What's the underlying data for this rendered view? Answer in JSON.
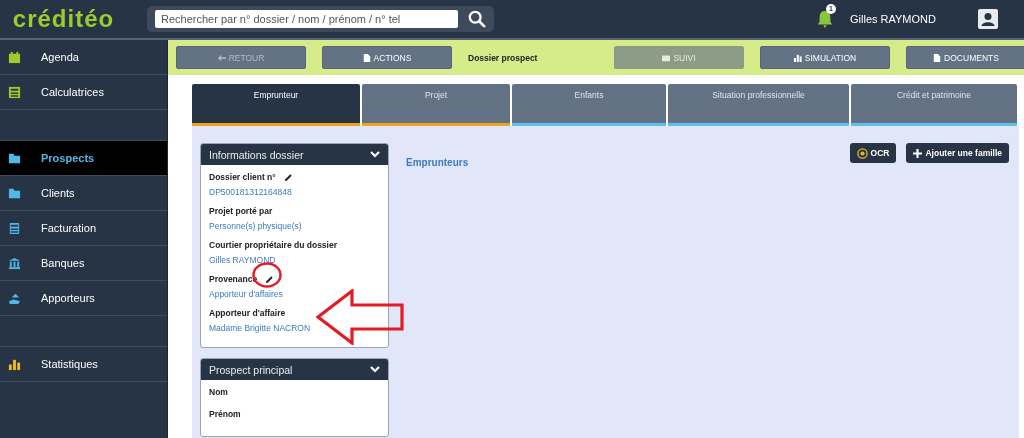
{
  "header": {
    "logo": "créditéo",
    "search": {
      "placeholder": "Rechercher par n° dossier / nom / prénom / n° tel"
    },
    "notifications": "1",
    "user": "Gilles RAYMOND"
  },
  "sidebar": {
    "items": [
      {
        "kind": "link",
        "label": "Agenda",
        "selected": false
      },
      {
        "kind": "link",
        "label": "Calculatrices",
        "selected": false
      },
      {
        "kind": "spacer"
      },
      {
        "kind": "link",
        "label": "Prospects",
        "selected": true
      },
      {
        "kind": "link",
        "label": "Clients",
        "selected": false
      },
      {
        "kind": "link",
        "label": "Facturation",
        "selected": false
      },
      {
        "kind": "link",
        "label": "Banques",
        "selected": false
      },
      {
        "kind": "link",
        "label": "Apporteurs",
        "selected": false
      },
      {
        "kind": "spacer"
      },
      {
        "kind": "link",
        "label": "Statistiques",
        "selected": false
      }
    ]
  },
  "toolbar": {
    "items": [
      {
        "kind": "button",
        "label": "RETOUR",
        "disabled": true
      },
      {
        "kind": "button",
        "label": "ACTIONS",
        "disabled": false
      },
      {
        "kind": "title",
        "label": "Dossier prospect"
      },
      {
        "kind": "button",
        "label": "SUIVI",
        "disabled": true
      },
      {
        "kind": "button",
        "label": "SIMULATION",
        "disabled": false
      },
      {
        "kind": "button",
        "label": "DOCUMENTS",
        "disabled": false
      }
    ]
  },
  "tabs": [
    {
      "label": "Emprunteur",
      "selected": true,
      "color": "#f0a31c"
    },
    {
      "label": "Projet",
      "selected": false,
      "color": "#f0a31c"
    },
    {
      "label": "Enfants",
      "selected": false,
      "color": "#5bc0ea"
    },
    {
      "label": "Situation professionnelle",
      "selected": false,
      "color": "#5bc0ea"
    },
    {
      "label": "Crédit et patrimoine",
      "selected": false,
      "color": "#5bc0ea"
    }
  ],
  "panels": [
    {
      "title": "Informations dossier",
      "fields": [
        {
          "label": "Dossier client n°",
          "value": "DP500181312164848",
          "editable": true
        },
        {
          "label": "Projet porté par",
          "value": "Personne(s) physique(s)",
          "editable": false
        },
        {
          "label": "Courtier propriétaire du dossier",
          "value": "Gilles RAYMOND",
          "editable": false
        },
        {
          "label": "Provenance",
          "value": "Apporteur d'affaires",
          "editable": true
        },
        {
          "label": "Apporteur d'affaire",
          "value": "Madame Brigitte NACRON",
          "editable": false
        }
      ]
    },
    {
      "title": "Prospect principal",
      "fields": [
        {
          "label": "Nom",
          "editable": false
        },
        {
          "label": "Prénom",
          "editable": false
        }
      ]
    }
  ],
  "section": {
    "title": "Emprunteurs",
    "buttons": [
      {
        "kind": "ocr",
        "label": "OCR"
      },
      {
        "kind": "add",
        "label": "Ajouter une famille"
      }
    ]
  }
}
